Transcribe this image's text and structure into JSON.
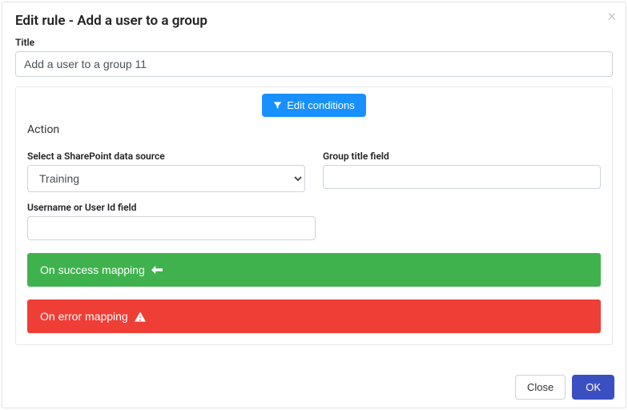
{
  "header": {
    "title": "Edit rule - Add a user to a group"
  },
  "title_field": {
    "label": "Title",
    "value": "Add a user to a group 11"
  },
  "edit_conditions": {
    "label": "Edit conditions"
  },
  "action": {
    "heading": "Action",
    "data_source": {
      "label": "Select a SharePoint data source",
      "value": "Training"
    },
    "group_title": {
      "label": "Group title field",
      "value": ""
    },
    "username": {
      "label": "Username or User Id field",
      "value": ""
    },
    "success_mapping": {
      "label": "On success mapping"
    },
    "error_mapping": {
      "label": "On error mapping"
    }
  },
  "footer": {
    "close": "Close",
    "ok": "OK"
  }
}
